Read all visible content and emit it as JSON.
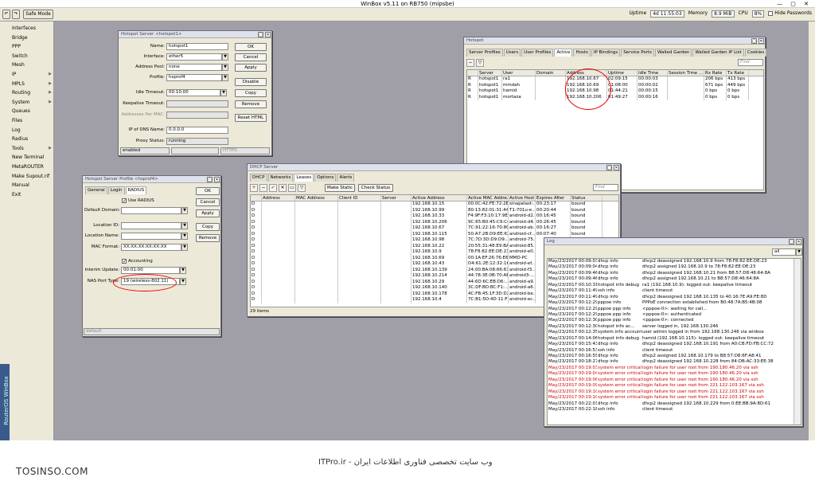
{
  "app": {
    "title": "WinBox v5.11 on RB750 (mipsbe)",
    "safe_mode": "Safe Mode"
  },
  "status": {
    "uptime_label": "Uptime",
    "uptime": "4d 11:55:03",
    "memory_label": "Memory",
    "memory": "8.9 MiB",
    "cpu_label": "CPU",
    "cpu": "8%",
    "hide_passwords": "Hide Passwords"
  },
  "sidebar": {
    "brand": "RouterOS WinBox",
    "items": [
      {
        "label": "Interfaces",
        "arrow": ""
      },
      {
        "label": "Bridge",
        "arrow": ""
      },
      {
        "label": "PPP",
        "arrow": ""
      },
      {
        "label": "Switch",
        "arrow": ""
      },
      {
        "label": "Mesh",
        "arrow": ""
      },
      {
        "label": "IP",
        "arrow": "▶"
      },
      {
        "label": "MPLS",
        "arrow": "▶"
      },
      {
        "label": "Routing",
        "arrow": "▶"
      },
      {
        "label": "System",
        "arrow": "▶"
      },
      {
        "label": "Queues",
        "arrow": ""
      },
      {
        "label": "Files",
        "arrow": ""
      },
      {
        "label": "Log",
        "arrow": ""
      },
      {
        "label": "Radius",
        "arrow": ""
      },
      {
        "label": "Tools",
        "arrow": "▶"
      },
      {
        "label": "New Terminal",
        "arrow": ""
      },
      {
        "label": "MetaROUTER",
        "arrow": ""
      },
      {
        "label": "Make Supout.rif",
        "arrow": ""
      },
      {
        "label": "Manual",
        "arrow": ""
      },
      {
        "label": "Exit",
        "arrow": ""
      }
    ]
  },
  "hs_server": {
    "title": "Hotspot Server <hotspot1>",
    "name_label": "Name:",
    "name": "hotspot1",
    "interface_label": "Interface:",
    "interface": "ether5",
    "pool_label": "Address Pool:",
    "pool": "none",
    "profile_label": "Profile:",
    "profile": "hsprof4",
    "idle_label": "Idle Timeout:",
    "idle": "00:10:00",
    "keepalive_label": "Keepalive Timeout:",
    "addr_mac_label": "Addresses Per MAC:",
    "dns_label": "IP of DNS Name:",
    "dns": "0.0.0.0",
    "proxy_label": "Proxy Status:",
    "proxy": "running",
    "footer_status": "enabled",
    "footer_proto": "HTTPS",
    "buttons": [
      "OK",
      "Cancel",
      "Apply",
      "Disable",
      "Copy",
      "Remove",
      "Reset HTML"
    ]
  },
  "hs_profile": {
    "title": "Hotspot Server Profile <hsprof4>",
    "tabs": [
      "General",
      "Login",
      "RADIUS"
    ],
    "use_radius": "Use RADIUS",
    "domain_label": "Default Domain:",
    "location_id_label": "Location ID:",
    "location_name_label": "Location Name:",
    "mac_format_label": "MAC Format:",
    "mac_format": "XX:XX:XX:XX:XX:XX",
    "accounting": "Accounting",
    "interim_label": "Interim Update:",
    "interim": "00:01:00",
    "nas_label": "NAS Port Type:",
    "nas": "19 (wireless-802.11)",
    "footer": "default",
    "buttons": [
      "OK",
      "Cancel",
      "Apply",
      "Copy",
      "Remove"
    ]
  },
  "hotspot": {
    "title": "Hotspot",
    "tabs": [
      "Server Profiles",
      "Users",
      "User Profiles",
      "Active",
      "Hosts",
      "IP Bindings",
      "Service Ports",
      "Walled Garden",
      "Walled Garden IP List",
      "Cookies"
    ],
    "find": "Find",
    "columns": [
      "",
      "Server",
      "User",
      "Domain",
      "Address",
      "Uptime",
      "Idle Time",
      "Session Time ...",
      "Rx Rate",
      "Tx Rate"
    ],
    "rows": [
      [
        "R",
        "hotspot1",
        "ra1",
        "",
        "192.168.10.67",
        "02:09:15",
        "00:00:03",
        "",
        "206 bps",
        "413 bps"
      ],
      [
        "R",
        "hotspot1",
        "mmdah",
        "",
        "192.168.10.69",
        "01:08:00",
        "00:00:02",
        "",
        "671 bps",
        "449 bps"
      ],
      [
        "R",
        "hotspot1",
        "hamid",
        "",
        "192.168.10.98",
        "01:44:21",
        "00:00:15",
        "",
        "0 bps",
        "0 bps"
      ],
      [
        "R",
        "hotspot1",
        "mortaza",
        "",
        "192.168.10.206",
        "01:49:27",
        "00:00:16",
        "",
        "0 bps",
        "0 bps"
      ]
    ]
  },
  "dhcp": {
    "title": "DHCP Server",
    "tabs": [
      "DHCP",
      "Networks",
      "Leases",
      "Options",
      "Alerts"
    ],
    "make_static": "Make Static",
    "check_status": "Check Status",
    "find": "Find",
    "columns": [
      "",
      "Address",
      "MAC Address",
      "Client ID",
      "Server",
      "Active Address",
      "Active MAC Addre...",
      "Active Host ...",
      "Expires After",
      "Status"
    ],
    "rows": [
      [
        "D",
        "",
        "",
        "",
        "",
        "192.168.10.15",
        "00:0C:42:FE:72:2E",
        "sinapelast-...",
        "00:23:17",
        "bound"
      ],
      [
        "D",
        "",
        "",
        "",
        "",
        "192.168.10.99",
        "80:13:82:01:31:44",
        "T1-701u-e...",
        "00:20:44",
        "bound"
      ],
      [
        "D",
        "",
        "",
        "",
        "",
        "192.168.10.33",
        "F4:9F:F3:10:17:9E",
        "android-d2...",
        "00:16:45",
        "bound"
      ],
      [
        "D",
        "",
        "",
        "",
        "",
        "192.168.10.206",
        "9C:65:B0:45:C9:C4",
        "android-d4...",
        "00:26:45",
        "bound"
      ],
      [
        "D",
        "",
        "",
        "",
        "",
        "192.168.10.67",
        "7C:91:22:16:70:8C",
        "android-ab...",
        "00:16:27",
        "bound"
      ],
      [
        "D",
        "",
        "",
        "",
        "",
        "192.168.10.115",
        "50:A7:2B:D9:EE:62",
        "android-cf...",
        "00:07:40",
        "bound"
      ],
      [
        "D",
        "",
        "",
        "",
        "",
        "192.168.10.98",
        "7C:7D:3D:D9:D9:...",
        "android-75...",
        "",
        ""
      ],
      [
        "D",
        "",
        "",
        "",
        "",
        "192.168.10.22",
        "20:55:31:48:E9:BA",
        "android-85...",
        "",
        ""
      ],
      [
        "D",
        "",
        "",
        "",
        "",
        "192.168.10.9",
        "78:F8:82:EE:DE:23",
        "android-e0...",
        "",
        ""
      ],
      [
        "D",
        "",
        "",
        "",
        "",
        "192.168.10.69",
        "00:1A:EF:26:76:E6",
        "MMD-PC",
        "",
        ""
      ],
      [
        "D",
        "",
        "",
        "",
        "",
        "192.168.10.43",
        "D4:61:2E:12:32:16",
        "android-ef...",
        "",
        ""
      ],
      [
        "D",
        "",
        "",
        "",
        "",
        "192.168.10.139",
        "24:00:BA:08:66:63",
        "android-f3...",
        "",
        ""
      ],
      [
        "D",
        "",
        "",
        "",
        "",
        "192.168.10.214",
        "44:78:3E:0B:70:AE",
        "android3-...",
        "",
        ""
      ],
      [
        "D",
        "",
        "",
        "",
        "",
        "192.168.10.29",
        "44:6D:6C:EB:D6:...",
        "android-a9...",
        "",
        ""
      ],
      [
        "D",
        "",
        "",
        "",
        "",
        "192.168.10.140",
        "3C:DF:BD:BC:F1:...",
        "android-a6...",
        "",
        ""
      ],
      [
        "D",
        "",
        "",
        "",
        "",
        "192.168.10.178",
        "4C:FB:45:1F:3D:D2",
        "android-be...",
        "",
        ""
      ],
      [
        "D",
        "",
        "",
        "",
        "",
        "192.168.10.4",
        "7C:B1:5D:4D:11:F8",
        "android-ec...",
        "",
        ""
      ]
    ],
    "count": "29 items"
  },
  "log": {
    "title": "Log",
    "filter": "all",
    "rows": [
      {
        "t": "May/23/2017 00:09:03",
        "topic": "dhcp info",
        "msg": "dhcp2 deassigned 192.168.10.9 from 78:F8:82:EE:DE:23",
        "err": false
      },
      {
        "t": "May/23/2017 00:09:04",
        "topic": "dhcp info",
        "msg": "dhcp2 assigned 192.168.10.9 to 78:F8:82:EE:DE:23",
        "err": false
      },
      {
        "t": "May/23/2017 00:09:46",
        "topic": "dhcp info",
        "msg": "dhcp2 deassigned 192.168.10.21 from B8:57:D8:46:64:8A",
        "err": false
      },
      {
        "t": "May/23/2017 00:09:46",
        "topic": "dhcp info",
        "msg": "dhcp2 assigned 192.168.10.21 to B8:57:D8:46:64:8A",
        "err": false
      },
      {
        "t": "May/23/2017 00:10:31",
        "topic": "hotspot info debug",
        "msg": "ra1 (192.168.10.9): logged out: keepalive timeout",
        "err": false
      },
      {
        "t": "May/23/2017 00:11:49",
        "topic": "ssh info",
        "msg": "client timeout",
        "err": false
      },
      {
        "t": "May/23/2017 00:11:49",
        "topic": "dhcp info",
        "msg": "dhcp2 deassigned 192.168.10.135 to 40:16:7E:A9:FE:8D",
        "err": false
      },
      {
        "t": "May/23/2017 00:12:29",
        "topic": "pppoe info",
        "msg": "PPPoE connection established from B0:48:7A:B5:4B:08",
        "err": false
      },
      {
        "t": "May/23/2017 00:12:29",
        "topic": "pppoe ppp info",
        "msg": "<pppoe-0>: waiting for call...",
        "err": false
      },
      {
        "t": "May/23/2017 00:12:29",
        "topic": "pppoe ppp info",
        "msg": "<pppoe-0>: authenticated",
        "err": false
      },
      {
        "t": "May/23/2017 00:12:30",
        "topic": "pppoe ppp info",
        "msg": "<pppoe-0>: connected",
        "err": false
      },
      {
        "t": "May/23/2017 00:12:30",
        "topic": "hotspot info ac...",
        "msg": "server logged in, 192.168.130.246",
        "err": false
      },
      {
        "t": "May/23/2017 00:12:35",
        "topic": "system info account",
        "msg": "user admin logged in from 192.168.130.246 via winbox",
        "err": false
      },
      {
        "t": "May/23/2017 00:14:06",
        "topic": "hotspot info debug",
        "msg": "hamid (192.168.10.115): logged out: keepalive timeout",
        "err": false
      },
      {
        "t": "May/23/2017 00:15:43",
        "topic": "dhcp info",
        "msg": "dhcp2 deassigned 192.168.10.191 from A0:CB:FD:FB:CC:72",
        "err": false
      },
      {
        "t": "May/23/2017 00:16:53",
        "topic": "ssh info",
        "msg": "client timeout",
        "err": false
      },
      {
        "t": "May/23/2017 00:16:55",
        "topic": "dhcp info",
        "msg": "dhcp2 assigned 192.168.10.179 to B8:57:D8:6F:A8:41",
        "err": false
      },
      {
        "t": "May/23/2017 00:18:27",
        "topic": "dhcp info",
        "msg": "dhcp2 deassigned 192.168.10.228 from 84:DB:AC:33:EE:38",
        "err": false
      },
      {
        "t": "May/23/2017 00:19:03",
        "topic": "system error critical",
        "msg": "login failure for user root from 190.180.46.20 via ssh",
        "err": true
      },
      {
        "t": "May/23/2017 00:19:04",
        "topic": "system error critical",
        "msg": "login failure for user root from 190.180.46.20 via ssh",
        "err": true
      },
      {
        "t": "May/23/2017 00:19:06",
        "topic": "system error critical",
        "msg": "login failure for user root from 190.180.46.20 via ssh",
        "err": true
      },
      {
        "t": "May/23/2017 00:19:09",
        "topic": "system error critical",
        "msg": "login failure for user root from 221.122.103.167 via ssh",
        "err": true
      },
      {
        "t": "May/23/2017 00:19:10",
        "topic": "system error critical",
        "msg": "login failure for user root from 221.122.103.167 via ssh",
        "err": true
      },
      {
        "t": "May/23/2017 00:19:10",
        "topic": "system error critical",
        "msg": "login failure for user root from 221.122.103.167 via ssh",
        "err": true
      },
      {
        "t": "May/23/2017 00:22:03",
        "topic": "dhcp info",
        "msg": "dhcp2 deassigned 192.168.10.229 from 0:EE:BB:9A:8D:61",
        "err": false
      },
      {
        "t": "May/23/2017 00:22:18",
        "topic": "ssh info",
        "msg": "client timeout",
        "err": false
      }
    ]
  },
  "watermark": {
    "left": "TOSINSO.COM",
    "center": "ITPro.ir - وب سایت تخصصی فناوری اطلاعات ایران"
  },
  "colors": {
    "desktop": "#a09fa8",
    "error_text": "#cc0000",
    "annotation": "#ee0000",
    "brand": "#3a5a8c"
  }
}
